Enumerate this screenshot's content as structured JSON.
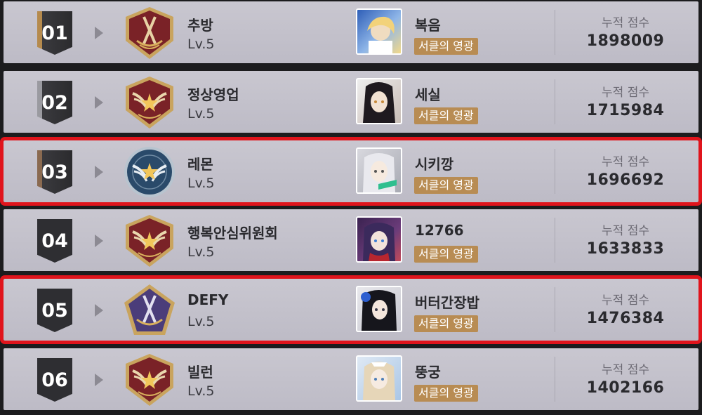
{
  "score_label": "누적 점수",
  "rows": [
    {
      "rank": "01",
      "guild": "추방",
      "level": "Lv.5",
      "member": "복음",
      "tag": "서클의 영광",
      "score": "1898009"
    },
    {
      "rank": "02",
      "guild": "정상영업",
      "level": "Lv.5",
      "member": "세실",
      "tag": "서클의 영광",
      "score": "1715984"
    },
    {
      "rank": "03",
      "guild": "레몬",
      "level": "Lv.5",
      "member": "시키깡",
      "tag": "서클의 영광",
      "score": "1696692"
    },
    {
      "rank": "04",
      "guild": "행복안심위원회",
      "level": "Lv.5",
      "member": "12766",
      "tag": "서클의 영광",
      "score": "1633833"
    },
    {
      "rank": "05",
      "guild": "DEFY",
      "level": "Lv.5",
      "member": "버터간장밥",
      "tag": "서클의 영광",
      "score": "1476384"
    },
    {
      "rank": "06",
      "guild": "빌런",
      "level": "Lv.5",
      "member": "뚱궁",
      "tag": "서클의 영광",
      "score": "1402166"
    }
  ],
  "emblems": [
    "sword-shield-icon",
    "wing-shield-icon",
    "wing-badge-icon",
    "wing-shield-icon",
    "sword-pentagon-icon",
    "wing-shield-icon"
  ],
  "colors": {
    "highlight": "#e0141c",
    "tag": "#b88c53",
    "emblem_red": "#7a2227",
    "emblem_blue": "#2a4a6a",
    "emblem_purple": "#4b3d7a"
  }
}
